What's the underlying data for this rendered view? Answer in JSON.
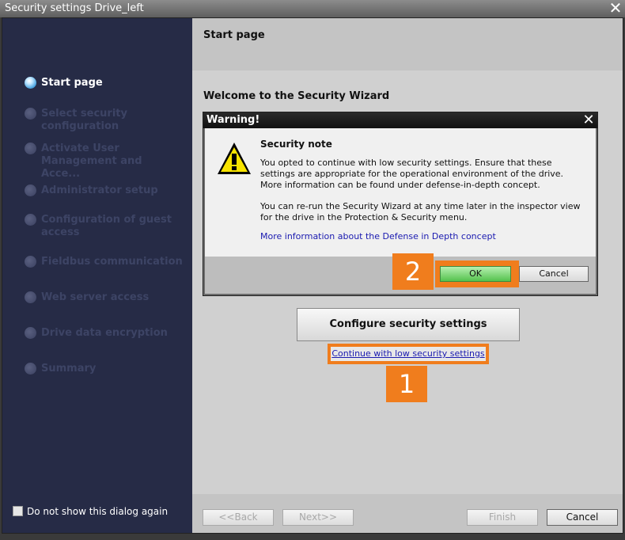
{
  "window": {
    "title": "Security settings Drive_left",
    "close_glyph": "✕"
  },
  "sidebar": {
    "steps": [
      {
        "label": "Start page",
        "state": "active"
      },
      {
        "label": "Select security configuration",
        "state": "inactive"
      },
      {
        "label": "Activate User Management and Acce...",
        "state": "inactive"
      },
      {
        "label": "Administrator setup",
        "state": "inactive"
      },
      {
        "label": "Configuration of guest access",
        "state": "inactive"
      },
      {
        "label": "Fieldbus communication",
        "state": "inactive"
      },
      {
        "label": "Web server access",
        "state": "inactive"
      },
      {
        "label": "Drive data encryption",
        "state": "inactive"
      },
      {
        "label": "Summary",
        "state": "inactive"
      }
    ],
    "dont_show_label": "Do not show this dialog again"
  },
  "main": {
    "page_title": "Start page",
    "welcome": "Welcome to the Security Wizard",
    "configure_button": "Configure security settings",
    "continue_link": "Continue with low security settings"
  },
  "dialog": {
    "title": "Warning!",
    "close_glyph": "✕",
    "note_title": "Security note",
    "paragraph1": [
      "You opted to continue with low security settings. Ensure that these",
      "settings are appropriate for the operational environment of the drive.",
      "More information can be found under defense-in-depth concept."
    ],
    "paragraph2": [
      "You can re-run the Security Wizard at any time later in the inspector view",
      "for the drive in the Protection & Security menu."
    ],
    "link": "More information about the Defense in Depth concept",
    "ok_label": "OK",
    "cancel_label": "Cancel"
  },
  "footer": {
    "back_label": "<<Back",
    "next_label": "Next>>",
    "finish_label": "Finish",
    "cancel_label": "Cancel"
  },
  "badges": {
    "one": "1",
    "two": "2"
  },
  "colors": {
    "sidebar": "#262b46",
    "highlight": "#f07d1d",
    "ok_green": "#55c24e",
    "link": "#1a1ab0"
  }
}
